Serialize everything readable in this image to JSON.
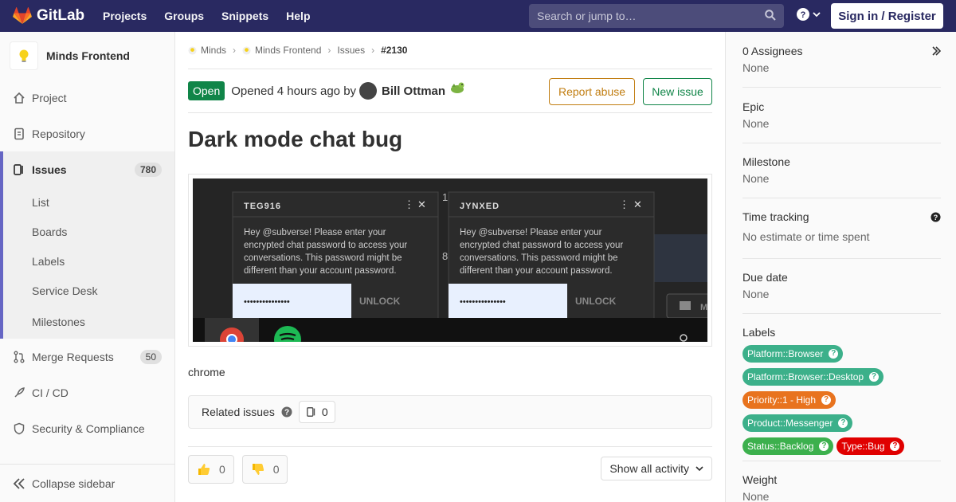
{
  "navbar": {
    "brand": "GitLab",
    "links": [
      "Projects",
      "Groups",
      "Snippets",
      "Help"
    ],
    "search_placeholder": "Search or jump to…",
    "signin_label": "Sign in / Register"
  },
  "sidebar": {
    "project_name": "Minds Frontend",
    "items": [
      {
        "label": "Project",
        "icon": "home-icon"
      },
      {
        "label": "Repository",
        "icon": "doc-icon"
      },
      {
        "label": "Issues",
        "count": "780",
        "icon": "issues-icon"
      },
      {
        "label": "Merge Requests",
        "count": "50",
        "icon": "merge-request-icon"
      },
      {
        "label": "CI / CD",
        "icon": "rocket-icon"
      },
      {
        "label": "Security & Compliance",
        "icon": "shield-icon"
      }
    ],
    "issue_subitems": [
      "List",
      "Boards",
      "Labels",
      "Service Desk",
      "Milestones"
    ],
    "collapse_label": "Collapse sidebar"
  },
  "breadcrumb": {
    "items": [
      "Minds",
      "Minds Frontend",
      "Issues"
    ],
    "current": "#2130"
  },
  "issue": {
    "status": "Open",
    "opened_text": "Opened 4 hours ago by",
    "author": "Bill Ottman",
    "report_label": "Report abuse",
    "new_label": "New issue",
    "title": "Dark mode chat bug",
    "description": "chrome",
    "related_label": "Related issues",
    "related_count": "0",
    "thumbs_up_count": "0",
    "thumbs_down_count": "0",
    "activity_label": "Show all activity"
  },
  "screenshot": {
    "left_user": "TEG916",
    "right_user": "JYNXED",
    "message_line1": "Hey @subverse! Please enter your",
    "message_line2": "encrypted chat password to access your",
    "message_line3": "conversations. This password might be",
    "message_line4": "different than your account password.",
    "password_mask": "•••••••••••••••",
    "unlock_label": "UNLOCK"
  },
  "right_sidebar": {
    "assignees_title": "0 Assignees",
    "assignees_value": "None",
    "epic_title": "Epic",
    "epic_value": "None",
    "milestone_title": "Milestone",
    "milestone_value": "None",
    "time_title": "Time tracking",
    "time_value": "No estimate or time spent",
    "due_title": "Due date",
    "due_value": "None",
    "labels_title": "Labels",
    "labels": [
      {
        "text": "Platform::Browser",
        "color": "#3cb08a"
      },
      {
        "text": "Platform::Browser::Desktop",
        "color": "#3cb08a"
      },
      {
        "text": "Priority::1 - High",
        "color": "#e8731e"
      },
      {
        "text": "Product::Messenger",
        "color": "#3cb08a"
      },
      {
        "text": "Status::Backlog",
        "color": "#3cb04d"
      },
      {
        "text": "Type::Bug",
        "color": "#e00000"
      }
    ],
    "weight_title": "Weight",
    "weight_value": "None"
  },
  "colors": {
    "navbar": "#292961",
    "open_badge": "#108548",
    "report": "#c17d10",
    "accent": "#6666c4"
  }
}
